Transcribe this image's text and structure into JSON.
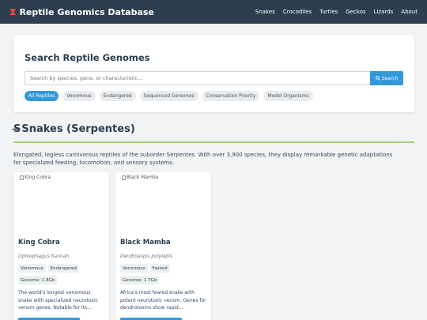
{
  "navbar": {
    "icon": "dna-icon",
    "title": "Reptile Genomics Database",
    "links": [
      "Snakes",
      "Crocodiles",
      "Turtles",
      "Geckos",
      "Lizards",
      "About"
    ]
  },
  "search": {
    "title": "Search Reptile Genomes",
    "placeholder": "Search by species, gene, or characteristic...",
    "button_label": "Search",
    "filters": [
      "All Reptiles",
      "Venomous",
      "Endangered",
      "Sequenced Genomes",
      "Conservation Priority",
      "Model Organisms"
    ],
    "active_filter": "All Reptiles"
  },
  "section": {
    "icon": "snake-icon",
    "title": "Snakes (Serpentes)",
    "description": "Elongated, legless carnivorous reptiles of the suborder Serpentes. With over 3,900 species, they display remarkable genetic adaptations for specialized feeding, locomotion, and sensory systems."
  },
  "cards": [
    {
      "image_alt": "King Cobra",
      "name": "King Cobra",
      "scientific_name": "Ophiophagus hannah",
      "tags": [
        "Venomous",
        "Endangered"
      ],
      "genome": "Genome: 1.8Gb",
      "description": "The world's longest venomous snake with specialized neurotoxic venom genes. Notable for its..."
    },
    {
      "image_alt": "Black Mamba",
      "name": "Black Mamba",
      "scientific_name": "Dendroaspis polylepis",
      "tags": [
        "Venomous",
        "Fastest"
      ],
      "genome": "Genome: 1.7Gb",
      "description": "Africa's most feared snake with potent neurotoxic venom. Genes for dendrotoxins show rapid..."
    }
  ],
  "colors": {
    "navbar_bg": "#2c3e50",
    "accent": "#3498db",
    "brand_icon": "#e74c3c",
    "section_rule": "#a3d47e"
  }
}
